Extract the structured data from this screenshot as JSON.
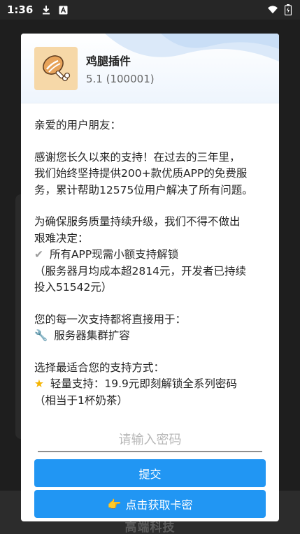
{
  "status_bar": {
    "time": "1:36",
    "icons": [
      "download-icon",
      "text-a-icon",
      "wifi-icon",
      "battery-icon"
    ]
  },
  "dialog": {
    "app_name": "鸡腿插件",
    "app_version": "5.1 (100001)",
    "greeting": "亲爱的用户朋友：",
    "para1_lines": [
      "感谢您长久以来的支持！在过去的三年里，",
      "我们始终坚持提供200+款优质APP的免费服",
      "务，累计帮助12575位用户解决了所有问题。"
    ],
    "para2_lines": [
      "为确保服务质量持续升级，我们不得不做出",
      "艰难决定："
    ],
    "para2_bullet": "所有APP现需小额支持解锁",
    "para2_note_lines": [
      "（服务器月均成本超2814元，开发者已持续",
      "投入51542元）"
    ],
    "para3_line": "您的每一次支持都将直接用于：",
    "para3_bullet": "服务器集群扩容",
    "para4_line": "选择最适合您的支持方式：",
    "para4_bullet": "轻量支持：19.9元即刻解锁全系列密码",
    "para4_note": "（相当于1杯奶茶）",
    "password_placeholder": "请输入密码",
    "submit_label": "提交",
    "get_card_label": "点击获取卡密",
    "glyphs": {
      "check": "✔",
      "wrench": "🔧",
      "star": "★",
      "pointing_hand": "👉"
    }
  },
  "background": {
    "footer_text": "高端科技"
  },
  "colors": {
    "accent": "#2196f3",
    "star": "#f5b400"
  }
}
